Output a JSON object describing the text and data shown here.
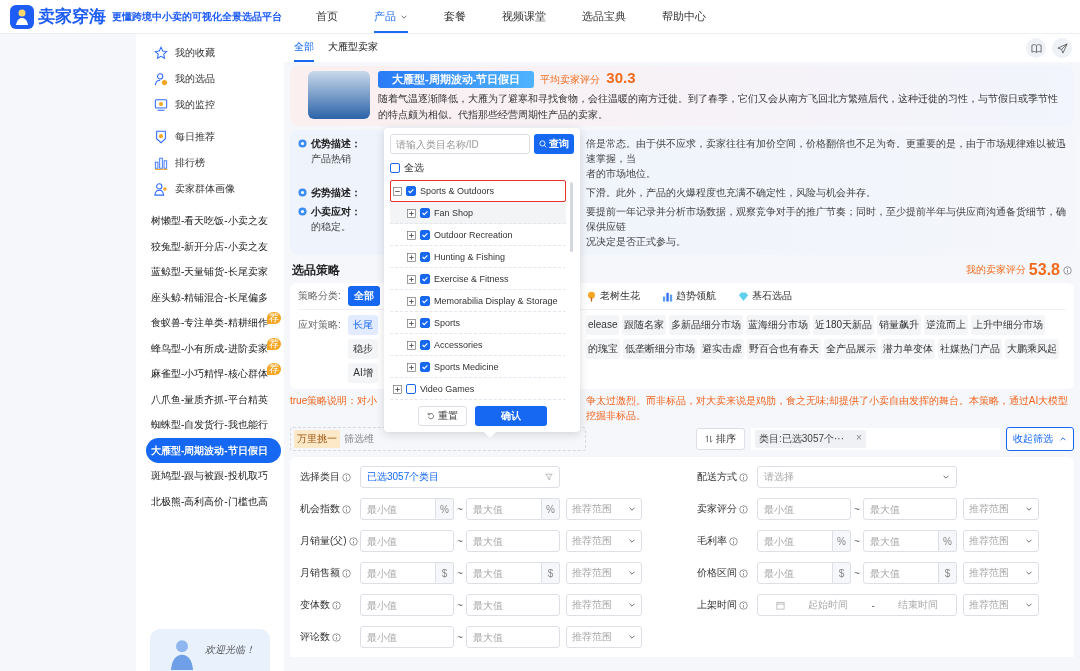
{
  "header": {
    "brand": "卖家穿海",
    "tagline": "更懂跨境中小卖的可视化全景选品平台",
    "nav": [
      {
        "label": "首页",
        "selected": false,
        "dropdown": false
      },
      {
        "label": "产品",
        "selected": true,
        "dropdown": true
      },
      {
        "label": "套餐",
        "selected": false,
        "dropdown": false
      },
      {
        "label": "视频课堂",
        "selected": false,
        "dropdown": false
      },
      {
        "label": "选品宝典",
        "selected": false,
        "dropdown": false
      },
      {
        "label": "帮助中心",
        "selected": false,
        "dropdown": false
      }
    ]
  },
  "sidebar": {
    "menu_groups": [
      [
        {
          "label": "我的收藏"
        },
        {
          "label": "我的选品"
        },
        {
          "label": "我的监控"
        }
      ],
      [
        {
          "label": "每日推荐"
        },
        {
          "label": "排行榜"
        },
        {
          "label": "卖家群体画像"
        }
      ]
    ],
    "types": [
      {
        "label": "树懒型-看天吃饭-小卖之友",
        "selected": false
      },
      {
        "label": "狡兔型-新开分店-小卖之友",
        "selected": false
      },
      {
        "label": "蓝鲸型-天量铺货-长尾卖家",
        "selected": false
      },
      {
        "label": "座头鲸-精铺混合-长尾偏多",
        "selected": false
      },
      {
        "label": "食蚁兽-专注单类-精耕细作",
        "selected": false,
        "badge": "荐"
      },
      {
        "label": "蜂鸟型-小有所成-进阶卖家",
        "selected": false,
        "badge": "荐"
      },
      {
        "label": "麻雀型-小巧精悍-核心群体",
        "selected": false,
        "badge": "荐"
      },
      {
        "label": "八爪鱼-量质齐抓-平台精英",
        "selected": false
      },
      {
        "label": "蜘蛛型-自发货行-我也能行",
        "selected": false
      },
      {
        "label": "大雁型-周期波动-节日假日",
        "selected": true
      },
      {
        "label": "斑鸠型-跟与被跟-投机取巧",
        "selected": false
      },
      {
        "label": "北极熊-高利高价-门槛也高",
        "selected": false
      }
    ],
    "welcome": "欢迎光临！"
  },
  "tabs": [
    {
      "label": "全部",
      "selected": true
    },
    {
      "label": "大雁型卖家",
      "selected": false
    }
  ],
  "hero": {
    "title": "大雁型-周期波动-节日假日",
    "rating_label": "平均卖家评分",
    "rating": "30.3",
    "description": "随着气温逐渐降低，大雁为了避寒和寻找食物，会往温暖的南方迁徙。到了春季，它们又会从南方飞回北方繁殖后代，这种迁徙的习性，与节假日或季节性的特点颇为相似。代指那些经营周期性产品的卖家。"
  },
  "insights": [
    {
      "label": "优势描述：",
      "left": [
        "产品热销"
      ],
      "right": [
        "倍是常态。由于供不应求，卖家往往有加价空间，价格翻倍也不足为奇。更重要的是，由于市场规律难以被迅速掌握，当",
        "者的市场地位。"
      ]
    },
    {
      "label": "劣势描述：",
      "right": [
        "下滑。此外，产品的火爆程度也充满不确定性，风险与机会并存。"
      ]
    },
    {
      "label": "小卖应对：",
      "left": [
        "的稳定。"
      ],
      "right": [
        "要提前一年记录并分析市场数据，观察竞争对手的推广节奏；同时，至少提前半年与供应商沟通备货细节，确保供应链",
        "况决定是否正式参与。"
      ]
    }
  ],
  "strategy": {
    "title": "选品策略",
    "score_label": "我的卖家评分",
    "score": "53.8",
    "category_label": "策略分类:",
    "categories": [
      [
        {
          "label": "全部",
          "selected": true
        }
      ],
      [
        {
          "label": "老树生花",
          "selected": false
        },
        {
          "label": "趋势领航",
          "selected": false
        },
        {
          "label": "基石选品",
          "selected": false
        }
      ]
    ],
    "tactic_label": "应对策略:",
    "tactic_rows": [
      [
        [
          {
            "label": "长尾",
            "selected": true
          }
        ],
        [
          {
            "label": "elease",
            "selected": false
          },
          {
            "label": "跟随名家",
            "selected": false
          },
          {
            "label": "多新品细分市场",
            "selected": false
          },
          {
            "label": "蓝海细分市场",
            "selected": false
          },
          {
            "label": "近180天新品",
            "selected": false
          },
          {
            "label": "销量飙升",
            "selected": false
          },
          {
            "label": "逆流而上",
            "selected": false
          },
          {
            "label": "上升中细分市场",
            "selected": false
          }
        ]
      ],
      [
        [
          {
            "label": "稳步",
            "selected": false
          }
        ],
        [
          {
            "label": "的瑰宝",
            "selected": false
          },
          {
            "label": "低垄断细分市场",
            "selected": false
          },
          {
            "label": "避实击虚",
            "selected": false
          },
          {
            "label": "野百合也有春天",
            "selected": false
          },
          {
            "label": "全产品展示",
            "selected": false
          },
          {
            "label": "潜力单变体",
            "selected": false
          },
          {
            "label": "社媒热门产品",
            "selected": false
          },
          {
            "label": "大鹏乘风起",
            "selected": false
          }
        ]
      ],
      [
        [
          {
            "label": "AI增",
            "selected": false
          }
        ],
        []
      ]
    ]
  },
  "note": {
    "left": "true策略说明：对小",
    "right": "争太过激烈。而非标品，对大卖来说是鸡肋，食之无味;却提供了小卖自由发挥的舞台。本策略，通过AI大模型挖掘非标品。"
  },
  "toolbar": {
    "tag": "万里挑一",
    "text": "筛选维",
    "sort": "排序",
    "filters": [
      {
        "label": "类目:已选3057个···",
        "remove": "×"
      }
    ],
    "collapse": "收起筛选"
  },
  "form": {
    "left": [
      {
        "label": "选择类目",
        "kind": "category",
        "value": "已选3057个类目"
      },
      {
        "label": "机会指数",
        "kind": "range",
        "min": {
          "placeholder": "最小值",
          "unit": "%"
        },
        "separator": "~",
        "max": {
          "placeholder": "最大值",
          "unit": "%"
        },
        "preset": "推荐范围"
      },
      {
        "label": "月销量(父)",
        "kind": "range",
        "min": {
          "placeholder": "最小值"
        },
        "separator": "~",
        "max": {
          "placeholder": "最大值"
        },
        "preset": "推荐范围"
      },
      {
        "label": "月销售额",
        "kind": "range",
        "min": {
          "placeholder": "最小值",
          "unit": "$"
        },
        "separator": "~",
        "max": {
          "placeholder": "最大值",
          "unit": "$"
        },
        "preset": "推荐范围"
      },
      {
        "label": "变体数",
        "kind": "range",
        "min": {
          "placeholder": "最小值"
        },
        "separator": "~",
        "max": {
          "placeholder": "最大值"
        },
        "preset": "推荐范围"
      },
      {
        "label": "评论数",
        "kind": "range",
        "min": {
          "placeholder": "最小值"
        },
        "separator": "~",
        "max": {
          "placeholder": "最大值"
        },
        "preset": "推荐范围"
      }
    ],
    "right": [
      {
        "label": "配送方式",
        "kind": "select",
        "placeholder": "请选择"
      },
      {
        "label": "卖家评分",
        "kind": "range",
        "min": {
          "placeholder": "最小值"
        },
        "separator": "~",
        "max": {
          "placeholder": "最大值"
        },
        "preset": "推荐范围"
      },
      {
        "label": "毛利率",
        "kind": "range",
        "min": {
          "placeholder": "最小值",
          "unit": "%"
        },
        "separator": "~",
        "max": {
          "placeholder": "最大值",
          "unit": "%"
        },
        "preset": "推荐范围"
      },
      {
        "label": "价格区间",
        "kind": "range",
        "min": {
          "placeholder": "最小值",
          "unit": "$"
        },
        "separator": "~",
        "max": {
          "placeholder": "最大值",
          "unit": "$"
        },
        "preset": "推荐范围"
      },
      {
        "label": "上架时间",
        "kind": "date",
        "start": "起始时间",
        "separator": "-",
        "end": "结束时间",
        "preset": "推荐范围"
      }
    ]
  },
  "popup": {
    "search_placeholder": "请输入类目名称/ID",
    "search_button": "查询",
    "select_all": {
      "label": "全选",
      "checked": false
    },
    "tree": [
      {
        "label": "Sports & Outdoors",
        "checked": true,
        "expanded": true,
        "hovered": false,
        "marked": true,
        "children": [
          {
            "label": "Fan Shop",
            "checked": true,
            "expanded": false,
            "hovered": true,
            "marked": false
          },
          {
            "label": "Outdoor Recreation",
            "checked": true,
            "expanded": false,
            "hovered": false,
            "marked": false
          },
          {
            "label": "Hunting & Fishing",
            "checked": true,
            "expanded": false,
            "hovered": false,
            "marked": false
          },
          {
            "label": "Exercise & Fitness",
            "checked": true,
            "expanded": false,
            "hovered": false,
            "marked": false
          },
          {
            "label": "Memorabilia Display & Storage",
            "checked": true,
            "expanded": false,
            "hovered": false,
            "marked": false
          },
          {
            "label": "Sports",
            "checked": true,
            "expanded": false,
            "hovered": false,
            "marked": false
          },
          {
            "label": "Accessories",
            "checked": true,
            "expanded": false,
            "hovered": false,
            "marked": false
          },
          {
            "label": "Sports Medicine",
            "checked": true,
            "expanded": false,
            "hovered": false,
            "marked": false
          }
        ]
      },
      {
        "label": "Video Games",
        "checked": false,
        "expanded": false,
        "hovered": false,
        "marked": false
      }
    ],
    "reset": "重置",
    "confirm": "确认"
  }
}
